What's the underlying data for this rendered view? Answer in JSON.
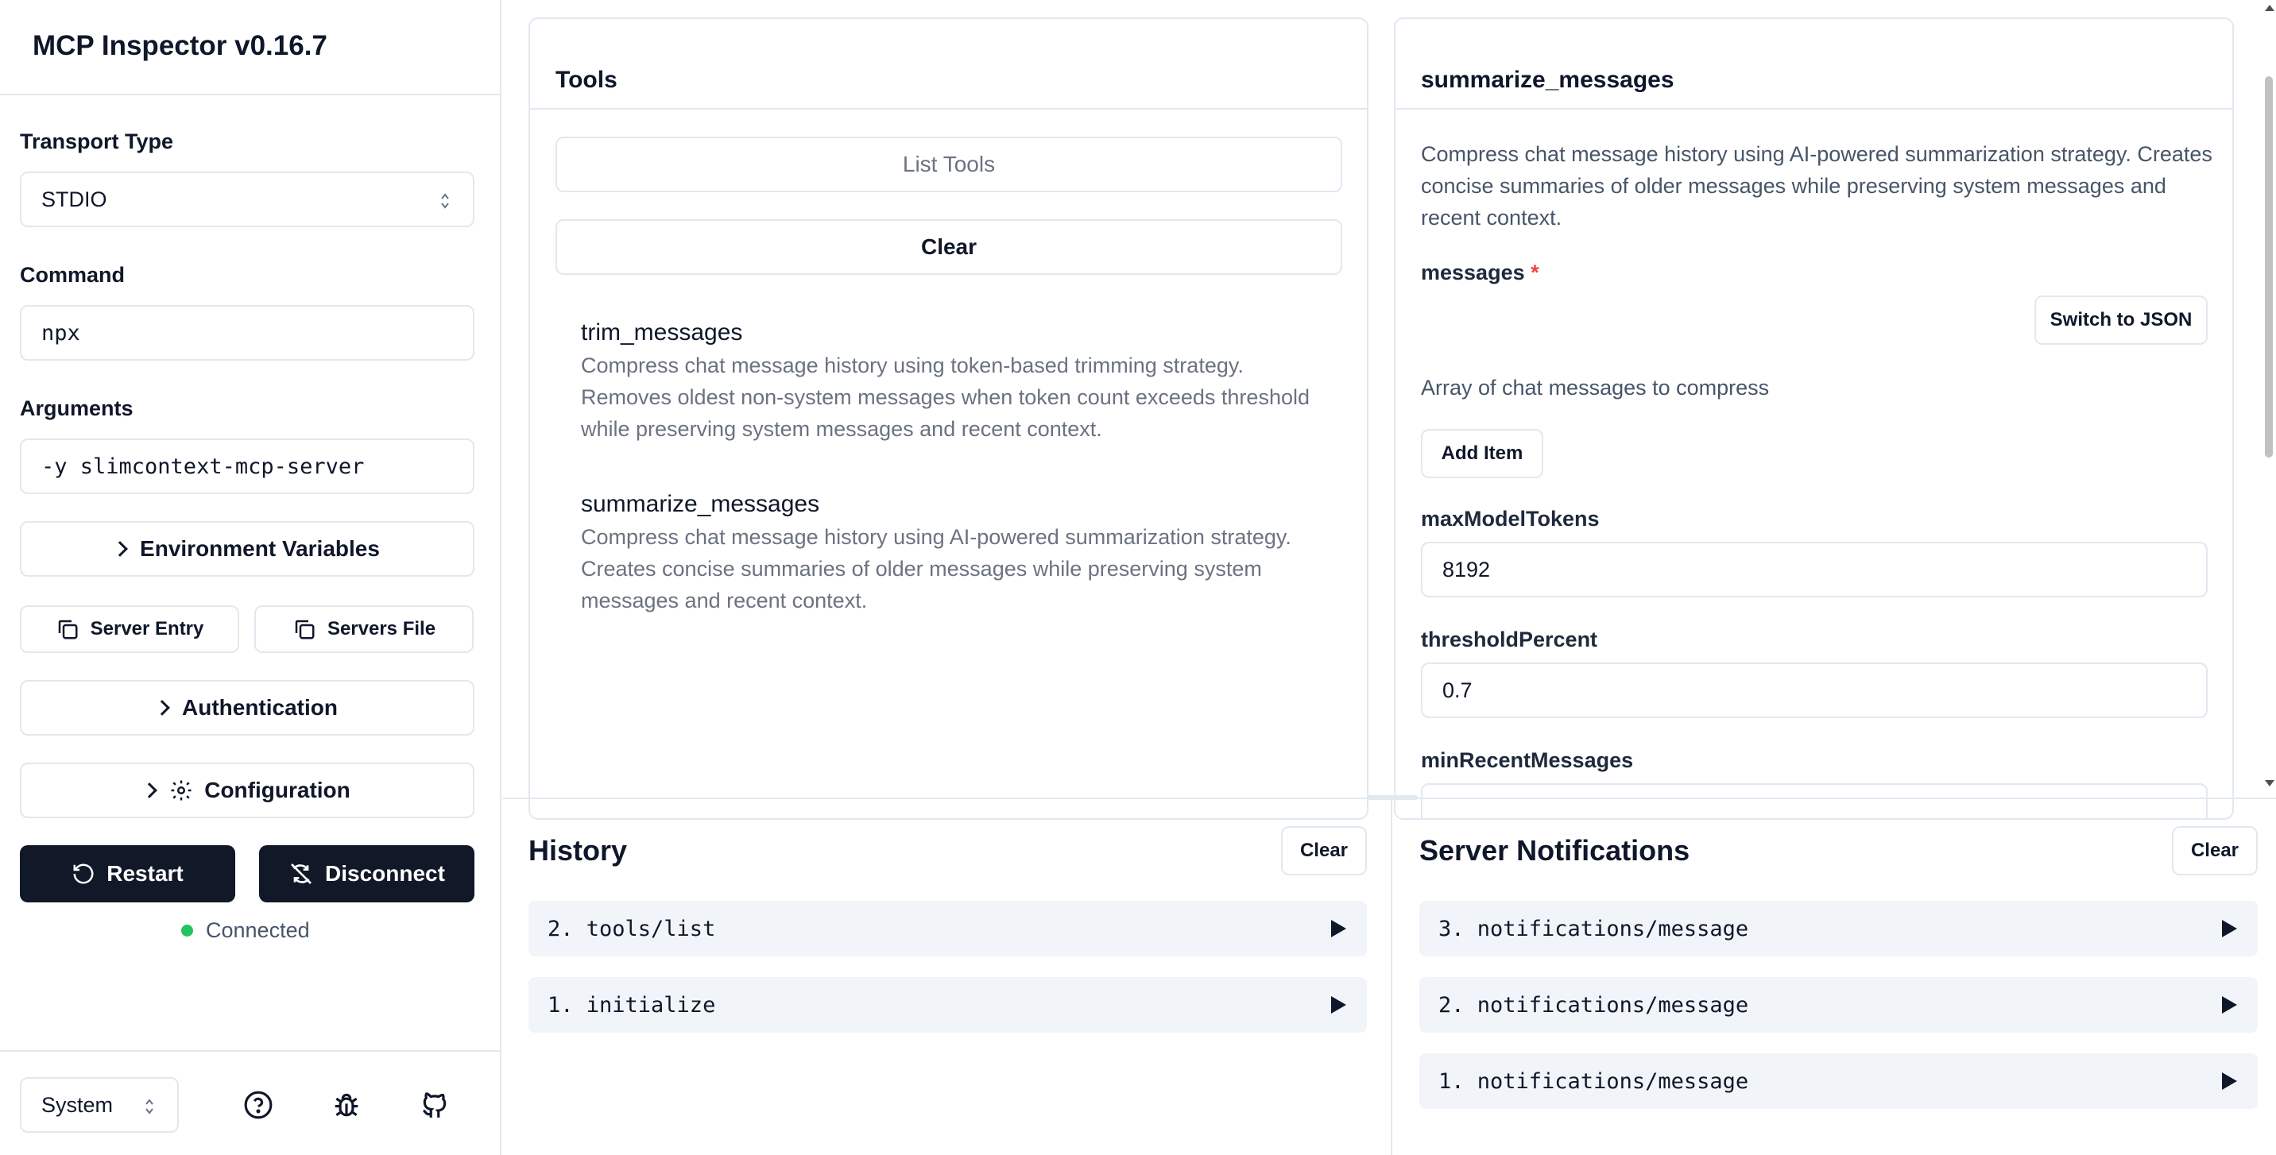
{
  "app": {
    "title": "MCP Inspector v0.16.7"
  },
  "sidebar": {
    "transport_label": "Transport Type",
    "transport_value": "STDIO",
    "command_label": "Command",
    "command_value": "npx",
    "arguments_label": "Arguments",
    "arguments_value": "-y slimcontext-mcp-server",
    "env_vars_label": "Environment Variables",
    "server_entry_label": "Server Entry",
    "servers_file_label": "Servers File",
    "authentication_label": "Authentication",
    "configuration_label": "Configuration",
    "restart_label": "Restart",
    "disconnect_label": "Disconnect",
    "status_text": "Connected",
    "status_color": "#22c55e",
    "theme_value": "System",
    "footer_icons": [
      "help-circle-icon",
      "bug-icon",
      "github-icon"
    ]
  },
  "tools_panel": {
    "title": "Tools",
    "list_tools_label": "List Tools",
    "clear_label": "Clear",
    "tools": [
      {
        "name": "trim_messages",
        "description": "Compress chat message history using token-based trimming strategy. Removes oldest non-system messages when token count exceeds threshold while preserving system messages and recent context."
      },
      {
        "name": "summarize_messages",
        "description": "Compress chat message history using AI-powered summarization strategy. Creates concise summaries of older messages while preserving system messages and recent context."
      }
    ]
  },
  "tool_detail": {
    "title": "summarize_messages",
    "description": "Compress chat message history using AI-powered summarization strategy. Creates concise summaries of older messages while preserving system messages and recent context.",
    "messages_label": "messages",
    "required_marker": "*",
    "switch_json_label": "Switch to JSON",
    "messages_desc": "Array of chat messages to compress",
    "add_item_label": "Add Item",
    "max_tokens_label": "maxModelTokens",
    "max_tokens_value": "8192",
    "threshold_label": "thresholdPercent",
    "threshold_value": "0.7",
    "min_recent_label": "minRecentMessages"
  },
  "history": {
    "title": "History",
    "clear_label": "Clear",
    "items": [
      "2. tools/list",
      "1. initialize"
    ]
  },
  "notifications": {
    "title": "Server Notifications",
    "clear_label": "Clear",
    "items": [
      "3. notifications/message",
      "2. notifications/message",
      "1. notifications/message"
    ]
  }
}
